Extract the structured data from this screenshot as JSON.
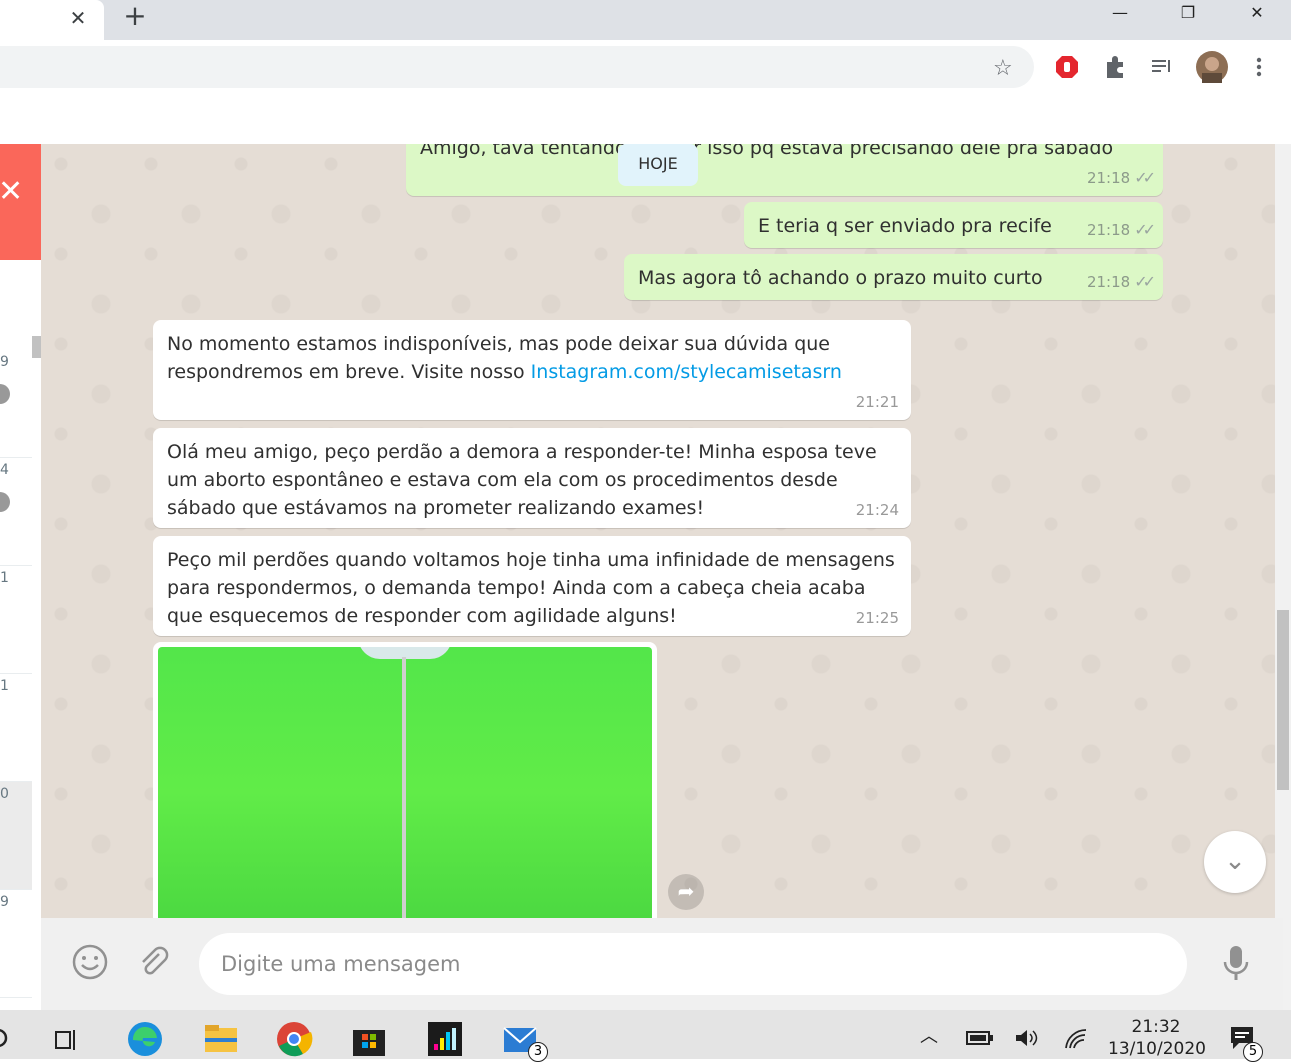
{
  "browser": {
    "tab_close": "✕",
    "new_tab": "+",
    "window_controls": {
      "minimize": "—",
      "maximize": "❐",
      "close": "✕"
    }
  },
  "toolbar": {
    "star_icon": "☆",
    "icons": [
      "adblock-icon",
      "extensions-icon",
      "media-icon",
      "profile-avatar",
      "menu-icon"
    ]
  },
  "sidebar": {
    "close_label": "✕",
    "items": [
      {
        "time": "9"
      },
      {
        "time": "4"
      },
      {
        "time": "1"
      },
      {
        "time": "1"
      },
      {
        "time": "0"
      },
      {
        "time": "9"
      }
    ]
  },
  "chat": {
    "day_label": "HOJE",
    "messages": [
      {
        "dir": "out",
        "text": "Amigo, tava tentando acertar isso pq estava precisando dele pra sábado",
        "time": "21:18"
      },
      {
        "dir": "out",
        "text": "E teria q ser enviado pra recife",
        "time": "21:18"
      },
      {
        "dir": "out",
        "text": "Mas agora tô achando o prazo muito curto",
        "time": "21:18"
      },
      {
        "dir": "in",
        "text": "No momento estamos indisponíveis, mas pode deixar sua dúvida que respondremos em breve. Visite nosso ",
        "link": "Instagram.com/stylecamisetasrn",
        "time": "21:21"
      },
      {
        "dir": "in",
        "text": "Olá meu amigo, peço perdão a demora a responder-te! Minha esposa teve um aborto espontâneo e estava com ela com os procedimentos desde sábado que estávamos na prometer realizando exames!",
        "time": "21:24"
      },
      {
        "dir": "in",
        "text": "Peço mil perdões quando voltamos hoje tinha uma infinidade de mensagens para respondermos, o demanda tempo! Ainda com a cabeça cheia acaba que esquecemos de responder com agilidade alguns!",
        "time": "21:25"
      }
    ]
  },
  "composer": {
    "placeholder": "Digite uma mensagem"
  },
  "taskbar": {
    "time": "21:32",
    "date": "13/10/2020",
    "mail_badge": "3",
    "notification_badge": "5"
  }
}
